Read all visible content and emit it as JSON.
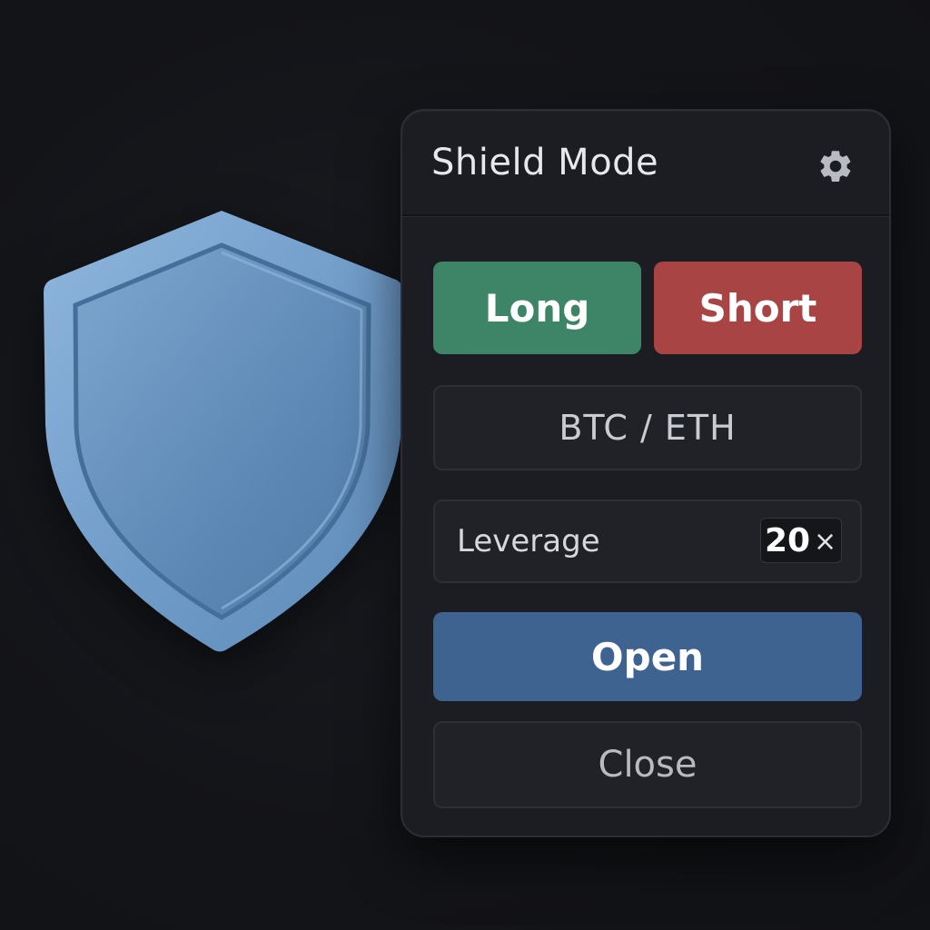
{
  "panel": {
    "title": "Shield Mode",
    "settings_icon": "gear-icon"
  },
  "direction": {
    "long_label": "Long",
    "short_label": "Short",
    "long_color": "#3d8566",
    "short_color": "#a94444"
  },
  "pair": {
    "value": "BTC / ETH"
  },
  "leverage": {
    "label": "Leverage",
    "value": "20",
    "unit": "×"
  },
  "actions": {
    "open_label": "Open",
    "close_label": "Close",
    "open_color": "#3e6391"
  },
  "decoration": {
    "shield_icon": "shield-icon",
    "shield_color": "#6f9bc8"
  }
}
